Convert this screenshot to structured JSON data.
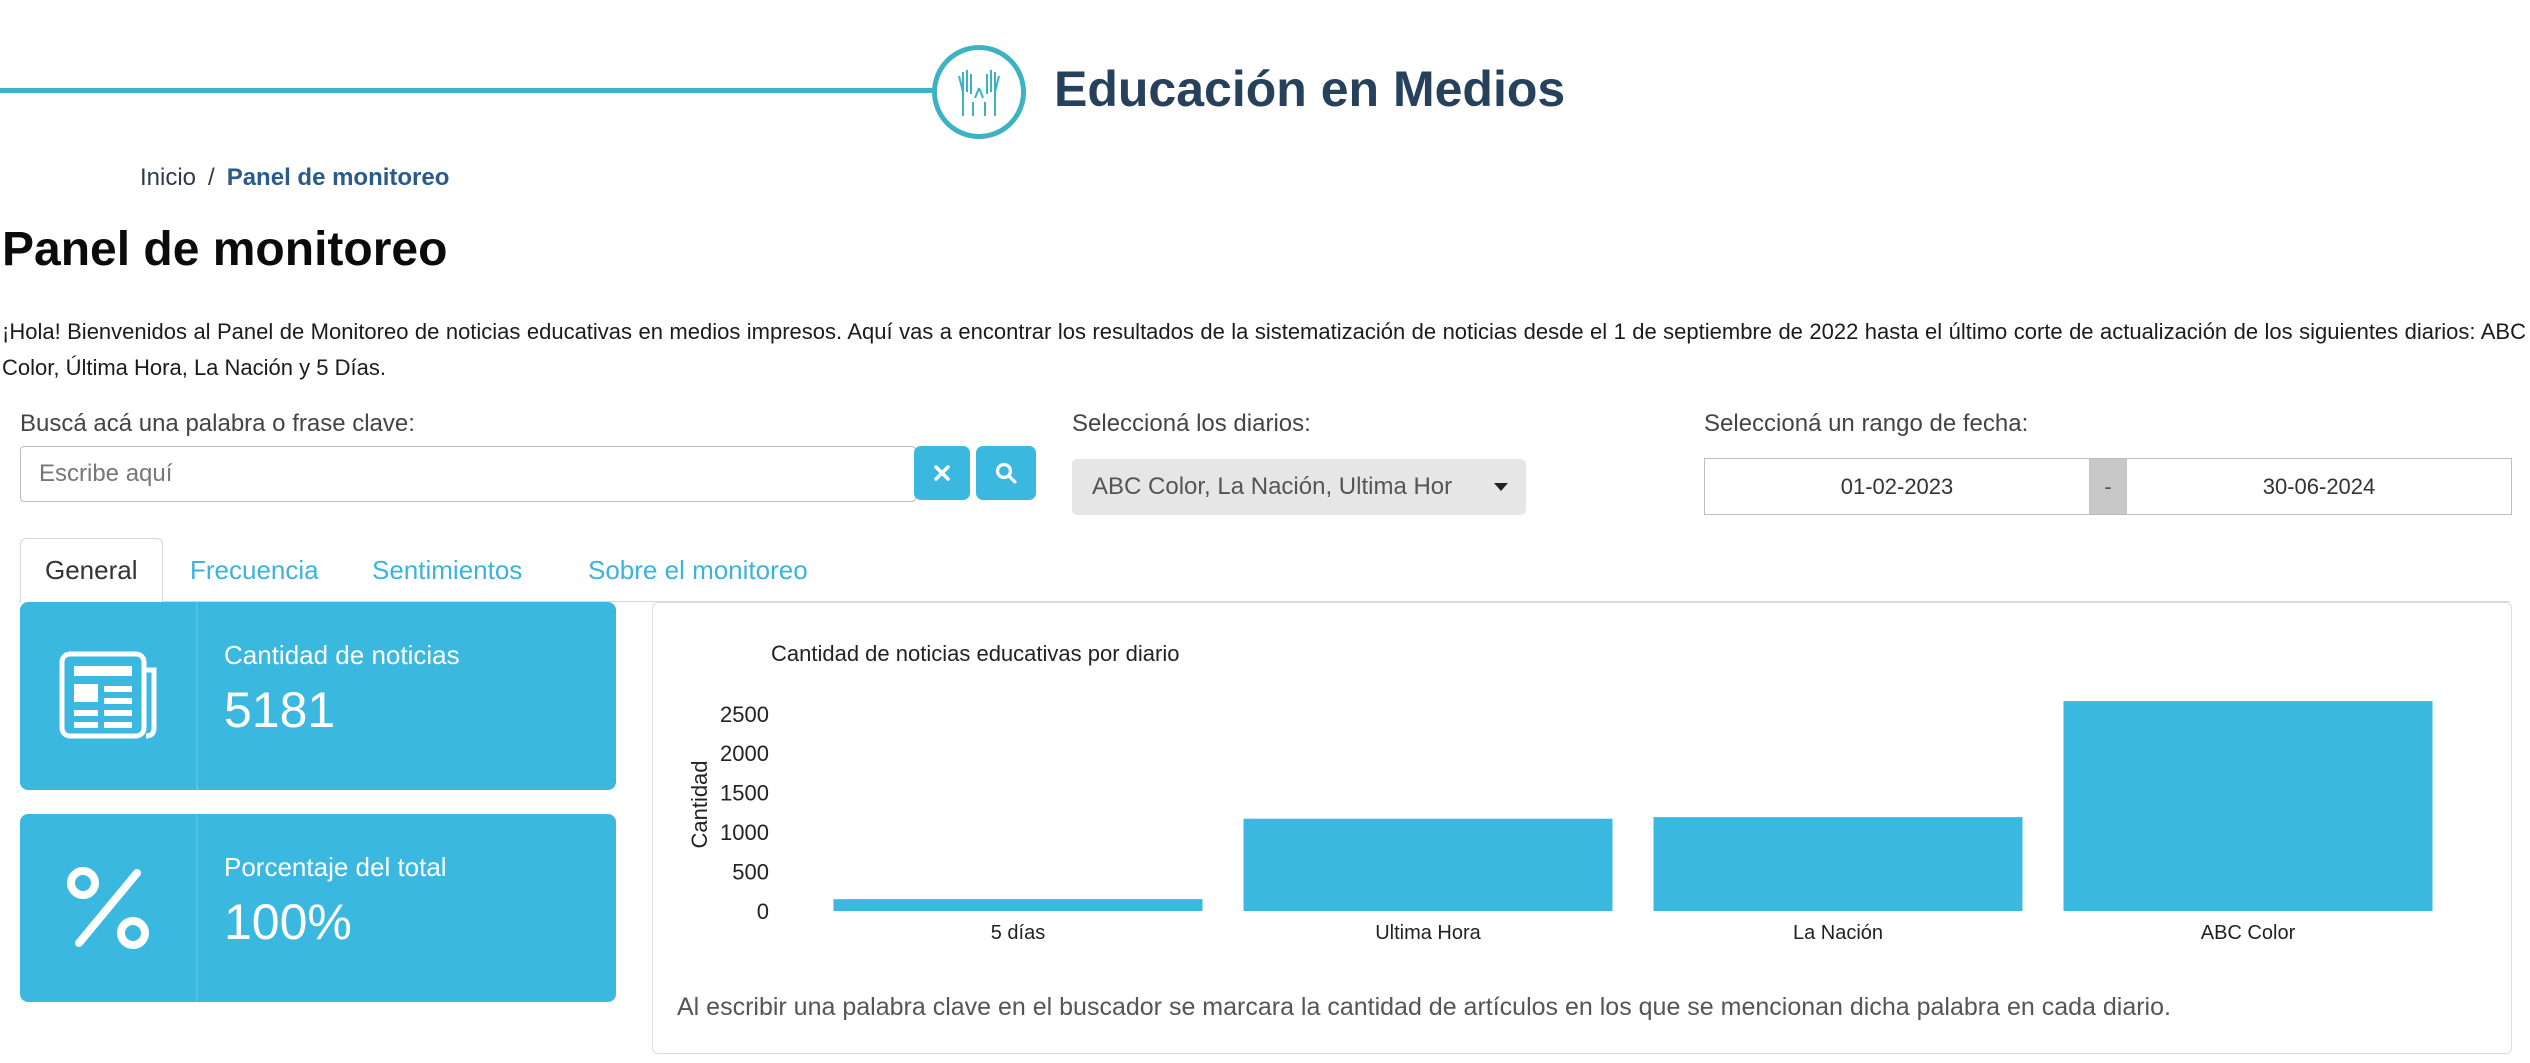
{
  "header": {
    "site_title": "Educación en Medios"
  },
  "breadcrumb": {
    "home": "Inicio",
    "separator": "/",
    "current": "Panel de monitoreo"
  },
  "page_title": "Panel de monitoreo",
  "intro_text": "¡Hola! Bienvenidos al Panel de Monitoreo de noticias educativas en medios impresos. Aquí vas a encontrar los resultados de la sistematización de noticias desde el 1 de septiembre de 2022 hasta el último corte de actualización de los siguientes diarios: ABC Color, Última Hora, La Nación y 5 Días.",
  "filters": {
    "search_label": "Buscá acá una palabra o frase clave:",
    "search_placeholder": "Escribe aquí",
    "papers_label": "Seleccioná los diarios:",
    "papers_selected": "ABC Color, La Nación, Ultima Hor",
    "date_label": "Seleccioná un rango de fecha:",
    "date_start": "01-02-2023",
    "date_sep": "-",
    "date_end": "30-06-2024"
  },
  "tabs": [
    {
      "label": "General"
    },
    {
      "label": "Frecuencia"
    },
    {
      "label": "Sentimientos"
    },
    {
      "label": "Sobre el monitoreo"
    }
  ],
  "cards": [
    {
      "label": "Cantidad de noticias",
      "value": "5181",
      "icon": "newspaper-icon"
    },
    {
      "label": "Porcentaje del total",
      "value": "100%",
      "icon": "percent-icon"
    }
  ],
  "colors": {
    "accent": "#3bb8e0",
    "header_line": "#3bb3c3",
    "title": "#27415c",
    "link": "#3bb3dc"
  },
  "chart_data": {
    "type": "bar",
    "title": "Cantidad de noticias educativas por diario",
    "xlabel": "",
    "ylabel": "Cantidad",
    "categories": [
      "5 días",
      "Ultima Hora",
      "La Nación",
      "ABC Color"
    ],
    "values": [
      150,
      1170,
      1190,
      2660
    ],
    "yticks": [
      0,
      500,
      1000,
      1500,
      2000,
      2500
    ],
    "ylim": [
      0,
      2700
    ],
    "grid": false,
    "color": "#3bb8e0"
  },
  "chart_note": "Al escribir una palabra clave en el buscador se marcara la cantidad de artículos en los que se mencionan dicha palabra en cada diario."
}
